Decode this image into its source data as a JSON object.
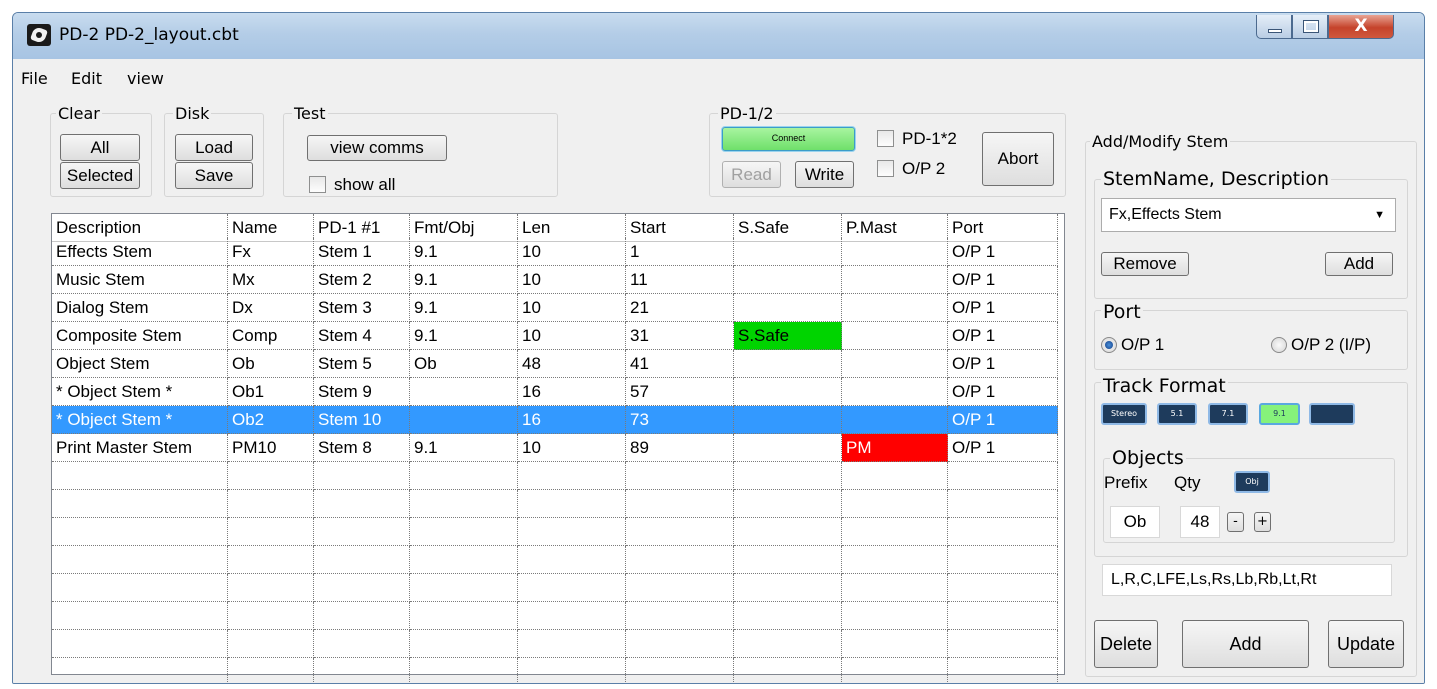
{
  "window": {
    "title": "PD-2  PD-2_layout.cbt",
    "close_glyph": "X"
  },
  "menu": [
    "File",
    "Edit",
    "view"
  ],
  "groups": {
    "clear": {
      "title": "Clear",
      "all": "All",
      "selected": "Selected"
    },
    "disk": {
      "title": "Disk",
      "load": "Load",
      "save": "Save"
    },
    "test": {
      "title": "Test",
      "view_comms": "view comms",
      "show_all": "show all"
    },
    "pd": {
      "title": "PD-1/2",
      "connect": "Connect",
      "read": "Read",
      "write": "Write",
      "pd1x2": "PD-1*2",
      "op2": "O/P 2",
      "abort": "Abort"
    }
  },
  "table": {
    "columns": [
      "Description",
      "Name",
      "PD-1 #1",
      "Fmt/Obj",
      "Len",
      "Start",
      "S.Safe",
      "P.Mast",
      "Port"
    ],
    "rows": [
      [
        "Effects Stem",
        "Fx",
        "Stem 1",
        "9.1",
        "10",
        "1",
        "",
        "",
        "O/P 1"
      ],
      [
        "Music Stem",
        "Mx",
        "Stem 2",
        "9.1",
        "10",
        "11",
        "",
        "",
        "O/P 1"
      ],
      [
        "Dialog Stem",
        "Dx",
        "Stem 3",
        "9.1",
        "10",
        "21",
        "",
        "",
        "O/P 1"
      ],
      [
        "Composite Stem",
        "Comp",
        "Stem 4",
        "9.1",
        "10",
        "31",
        "S.Safe",
        "",
        "O/P 1"
      ],
      [
        "Object Stem",
        "Ob",
        "Stem 5",
        "Ob",
        "48",
        "41",
        "",
        "",
        "O/P 1"
      ],
      [
        "* Object Stem *",
        "Ob1",
        "Stem 9",
        "",
        "16",
        "57",
        "",
        "",
        "O/P 1"
      ],
      [
        "* Object Stem *",
        "Ob2",
        "Stem 10",
        "",
        "16",
        "73",
        "",
        "",
        "O/P 1"
      ],
      [
        "Print Master Stem",
        "PM10",
        "Stem 8",
        "9.1",
        "10",
        "89",
        "",
        "PM",
        "O/P 1"
      ]
    ],
    "selected_row": 6
  },
  "panel": {
    "title": "Add/Modify Stem",
    "stem_group_title": "StemName, Description",
    "stem_value": "Fx,Effects Stem",
    "remove": "Remove",
    "add_small": "Add",
    "port_title": "Port",
    "port_op1": "O/P 1",
    "port_op2": "O/P 2 (I/P)",
    "track_format_title": "Track Format",
    "formats": [
      "Stereo",
      "5.1",
      "7.1",
      "9.1",
      ""
    ],
    "objects_title": "Objects",
    "prefix_label": "Prefix",
    "qty_label": "Qty",
    "obj_button": "Obj",
    "prefix_value": "Ob",
    "qty_value": "48",
    "minus": "-",
    "plus": "+",
    "channels": "L,R,C,LFE,Ls,Rs,Lb,Rb,Lt,Rt",
    "delete": "Delete",
    "add": "Add",
    "update": "Update"
  }
}
